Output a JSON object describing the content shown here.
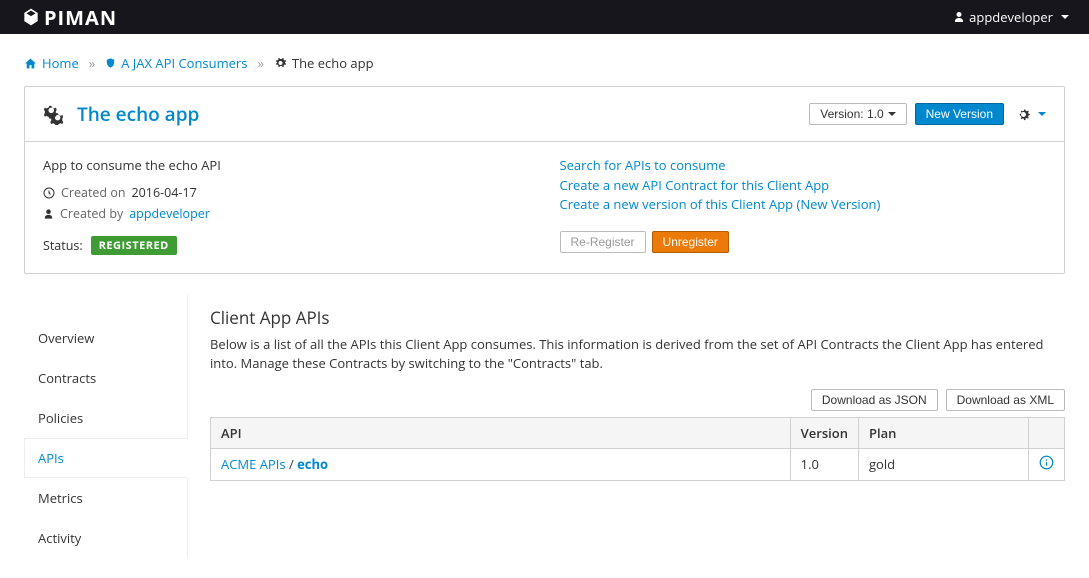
{
  "brand": "PIMAN",
  "user": "appdeveloper",
  "breadcrumb": {
    "home": "Home",
    "org": "A JAX API Consumers",
    "app": "The echo app"
  },
  "header": {
    "title": "The echo app",
    "version_label": "Version: 1.0",
    "new_version": "New Version"
  },
  "info": {
    "description": "App to consume the echo API",
    "created_on_label": "Created on",
    "created_date": "2016-04-17",
    "created_by_label": "Created by",
    "created_by": "appdeveloper",
    "status_label": "Status:",
    "status_value": "REGISTERED"
  },
  "quick_links": {
    "l1": "Search for APIs to consume",
    "l2": "Create a new API Contract for this Client App",
    "l3": "Create a new version of this Client App (New Version)",
    "re_register": "Re-Register",
    "unregister": "Unregister"
  },
  "tabs": {
    "overview": "Overview",
    "contracts": "Contracts",
    "policies": "Policies",
    "apis": "APIs",
    "metrics": "Metrics",
    "activity": "Activity"
  },
  "panel": {
    "title": "Client App APIs",
    "description": "Below is a list of all the APIs this Client App consumes. This information is derived from the set of API Contracts the Client App has entered into. Manage these Contracts by switching to the \"Contracts\" tab.",
    "download_json": "Download as JSON",
    "download_xml": "Download as XML"
  },
  "table": {
    "col_api": "API",
    "col_version": "Version",
    "col_plan": "Plan",
    "row": {
      "org": "ACME APIs",
      "sep": " / ",
      "api": "echo",
      "version": "1.0",
      "plan": "gold"
    }
  }
}
